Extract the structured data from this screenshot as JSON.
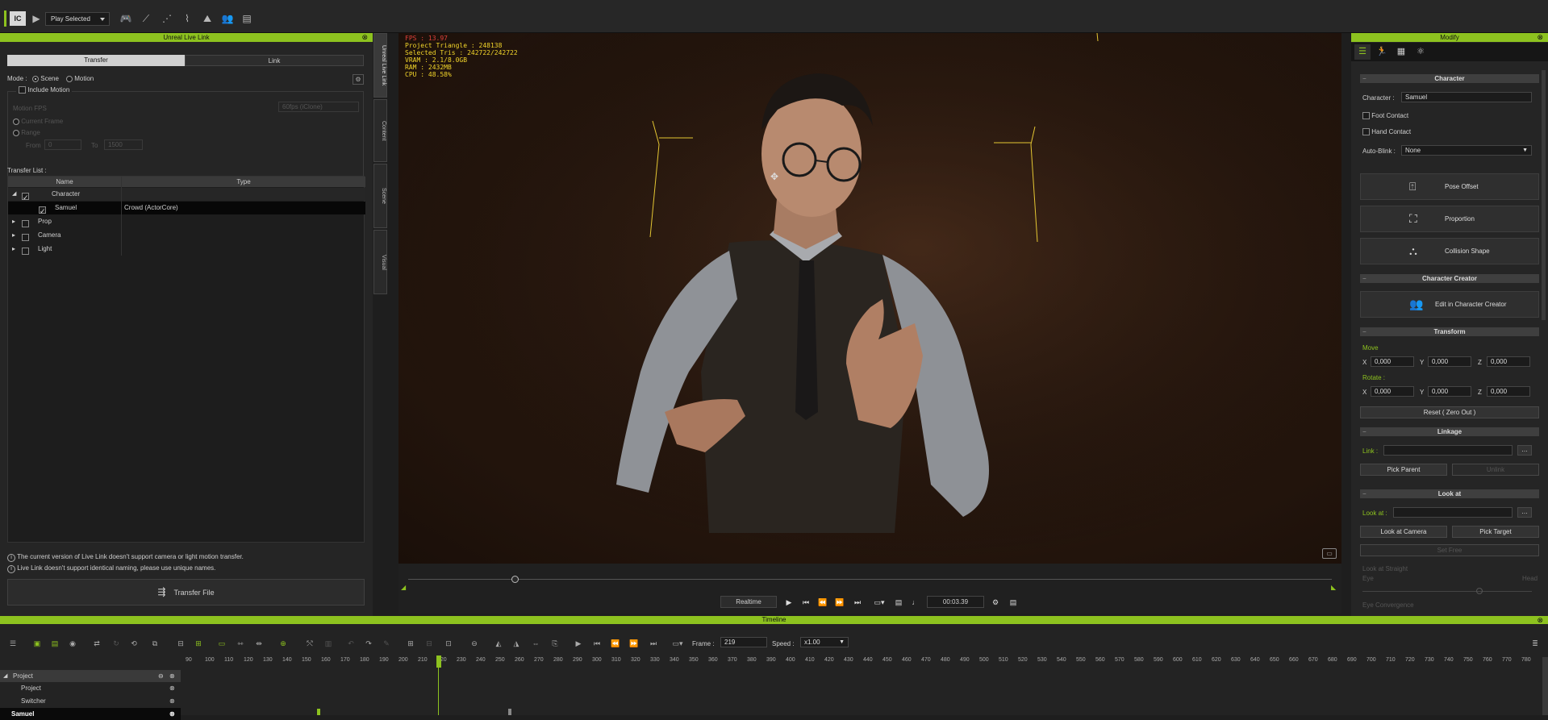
{
  "toolbar": {
    "logo": "IC",
    "play_mode": "Play Selected"
  },
  "live_link": {
    "title": "Unreal Live Link",
    "tabs": [
      "Transfer",
      "Link"
    ],
    "mode_label": "Mode :",
    "mode_options": [
      "Scene",
      "Motion"
    ],
    "include_motion": "Include Motion",
    "motion_fps": "Motion FPS",
    "fps_value": "60fps (iClone)",
    "current_frame": "Current Frame",
    "range": "Range",
    "from_label": "From",
    "from_value": "0",
    "to_label": "To",
    "to_value": "1500",
    "transfer_list_label": "Transfer List :",
    "col_name": "Name",
    "col_type": "Type",
    "rows": [
      {
        "name": "Character",
        "type": ""
      },
      {
        "name": "Samuel",
        "type": "Crowd (ActorCore)"
      },
      {
        "name": "Prop",
        "type": ""
      },
      {
        "name": "Camera",
        "type": ""
      },
      {
        "name": "Light",
        "type": ""
      }
    ],
    "notes": [
      "The current version of Live Link doesn't support camera or light motion transfer.",
      "Live Link doesn't support identical naming, please use unique names."
    ],
    "transfer_file": "Transfer File",
    "side_tabs": [
      "Unreal Live Link",
      "Content",
      "Scene",
      "Visual"
    ]
  },
  "viewport": {
    "hud": {
      "fps": "FPS : 13.97",
      "project_triangle": "Project Triangle : 248138",
      "selected_tris": "Selected Tris : 242722/242722",
      "vram": "VRAM : 2.1/8.0GB",
      "ram": "RAM : 2432MB",
      "cpu": "CPU : 48.58%"
    }
  },
  "playback": {
    "realtime": "Realtime",
    "time": "00:03.39"
  },
  "modify": {
    "title": "Modify",
    "character_section": "Character",
    "character_label": "Character :",
    "character_value": "Samuel",
    "foot_contact": "Foot Contact",
    "hand_contact": "Hand Contact",
    "auto_blink_label": "Auto-Blink :",
    "auto_blink_value": "None",
    "pose_offset": "Pose Offset",
    "proportion": "Proportion",
    "collision_shape": "Collision Shape",
    "cc_section": "Character Creator",
    "edit_cc": "Edit in Character Creator",
    "transform_section": "Transform",
    "move_label": "Move",
    "rotate_label": "Rotate :",
    "x": "X",
    "y": "Y",
    "z": "Z",
    "move_values": [
      "0,000",
      "0,000",
      "0,000"
    ],
    "rotate_values": [
      "0,000",
      "0,000",
      "0,000"
    ],
    "reset": "Reset ( Zero Out )",
    "linkage_section": "Linkage",
    "link_label": "Link :",
    "pick_parent": "Pick Parent",
    "unlink": "Unlink",
    "lookat_section": "Look at",
    "lookat_label": "Look at :",
    "look_at_camera": "Look at Camera",
    "pick_target": "Pick Target",
    "set_free": "Set Free",
    "look_straight": "Look at Straight",
    "eye": "Eye",
    "head": "Head",
    "eye_convergence": "Eye Convergence"
  },
  "timeline": {
    "title": "Timeline",
    "frame_label": "Frame :",
    "frame_value": "219",
    "speed_label": "Speed :",
    "speed_value": "x1.00",
    "ruler": [
      "90",
      "100",
      "110",
      "120",
      "130",
      "140",
      "150",
      "160",
      "170",
      "180",
      "190",
      "200",
      "210",
      "220",
      "230",
      "240",
      "250",
      "260",
      "270",
      "280",
      "290",
      "300",
      "310",
      "320",
      "330",
      "340",
      "350",
      "360",
      "370",
      "380",
      "390",
      "400",
      "410",
      "420",
      "430",
      "440",
      "450",
      "460",
      "470",
      "480",
      "490",
      "500",
      "510",
      "520",
      "530",
      "540",
      "550",
      "560",
      "570",
      "580",
      "590",
      "600",
      "610",
      "620",
      "630",
      "640",
      "650",
      "660",
      "670",
      "680",
      "690",
      "700",
      "710",
      "720",
      "730",
      "740",
      "750",
      "760",
      "770",
      "780"
    ],
    "tracks": [
      "Project",
      "Project",
      "Switcher",
      "Samuel"
    ]
  },
  "colors": {
    "accent": "#8dc21f",
    "hud": "#f2d52a"
  }
}
